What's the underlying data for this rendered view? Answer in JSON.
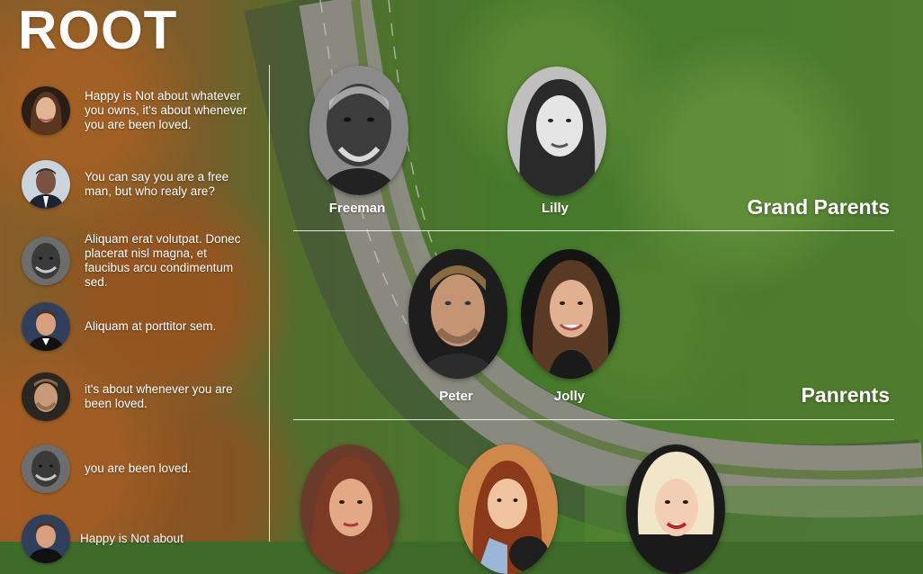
{
  "app": {
    "title": "ROOT"
  },
  "quotes": [
    {
      "avatar": "woman-long-brown-hair-avatar",
      "text": "Happy is Not about whatever you owns, it's about whenever you are been loved."
    },
    {
      "avatar": "man-suit-smiling-avatar",
      "text": "You can say you are a free man, but who realy are?"
    },
    {
      "avatar": "older-man-grayscale-avatar",
      "text": "Aliquam erat volutpat. Donec placerat nisl magna, et faucibus arcu condimentum sed."
    },
    {
      "avatar": "man-tuxedo-avatar",
      "text": "Aliquam at porttitor sem."
    },
    {
      "avatar": "man-stubble-avatar",
      "text": " it's about whenever you are been loved."
    },
    {
      "avatar": "older-man-grayscale-avatar",
      "text": "you are been loved."
    },
    {
      "avatar": "man-tuxedo-avatar",
      "text": "Happy is Not about"
    }
  ],
  "generations": [
    {
      "title": "Grand Parents",
      "members": [
        {
          "name": "Freeman",
          "portrait": "older-man-grayscale-portrait"
        },
        {
          "name": "Lilly",
          "portrait": "woman-vintage-grayscale-portrait"
        }
      ]
    },
    {
      "title": "Panrents",
      "members": [
        {
          "name": "Peter",
          "portrait": "man-stubble-portrait"
        },
        {
          "name": "Jolly",
          "portrait": "woman-long-brown-hair-portrait"
        }
      ]
    },
    {
      "title": "",
      "members": [
        {
          "name": "",
          "portrait": "woman-vintage-color-portrait"
        },
        {
          "name": "",
          "portrait": "girl-with-dog-portrait"
        },
        {
          "name": "",
          "portrait": "blonde-woman-portrait"
        }
      ]
    }
  ],
  "colors": {
    "forest_green": "#4f8a32",
    "autumn_orange": "#b8692a",
    "road_gray": "#8c8c84",
    "text_white": "#ffffff"
  }
}
